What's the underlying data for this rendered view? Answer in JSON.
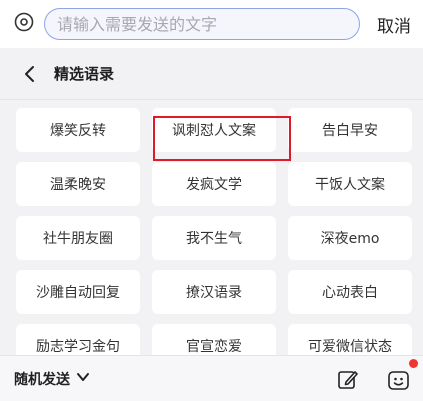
{
  "search": {
    "placeholder": "请输入需要发送的文字",
    "cancel_label": "取消"
  },
  "header": {
    "title": "精选语录"
  },
  "phrases": [
    "爆笑反转",
    "讽刺怼人文案",
    "告白早安",
    "温柔晚安",
    "发疯文学",
    "干饭人文案",
    "社牛朋友圈",
    "我不生气",
    "深夜emo",
    "沙雕自动回复",
    "撩汉语录",
    "心动表白",
    "励志学习金句",
    "官宣恋爱",
    "可爱微信状态"
  ],
  "highlighted_item": "讽刺怼人文案",
  "bottom": {
    "random_send_label": "随机发送"
  },
  "icons": {
    "mode": "mode-toggle-icon",
    "back": "chevron-left-icon",
    "dropdown": "chevron-down-icon",
    "edit": "edit-icon",
    "emoji": "emoji-icon"
  },
  "colors": {
    "highlight": "#e0192b",
    "search_border": "#8fa4e6",
    "notification_dot": "#f0352e"
  }
}
